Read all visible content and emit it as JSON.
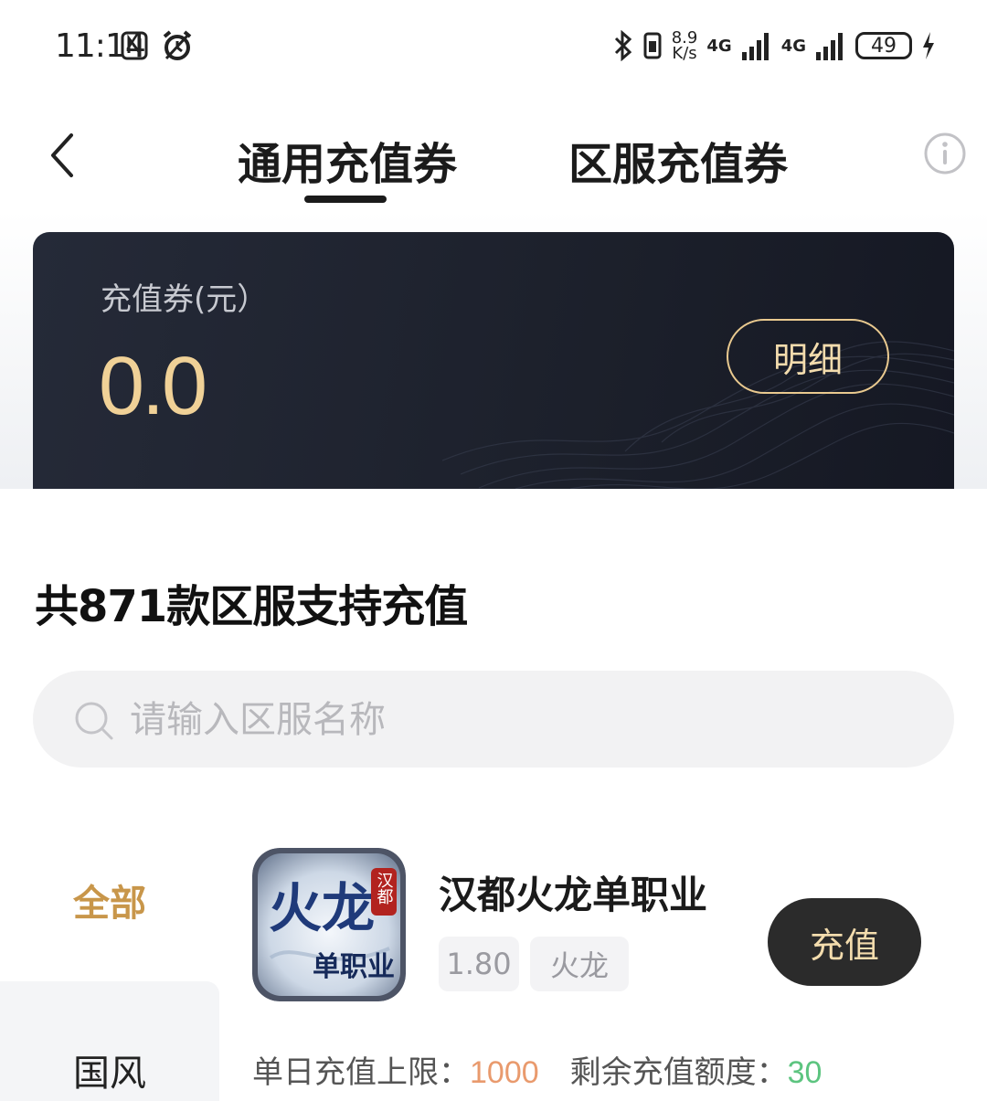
{
  "status_bar": {
    "time": "11:14",
    "net_speed_value": "8.9",
    "net_speed_unit": "K/s",
    "network_1": "4G",
    "network_2": "4G",
    "battery": "49",
    "icons": [
      "nfc-icon",
      "alarm-icon",
      "bluetooth-icon",
      "vibrate-icon",
      "signal-icon",
      "charging-icon"
    ]
  },
  "header": {
    "tabs": [
      {
        "label": "通用充值券",
        "active": true
      },
      {
        "label": "区服充值券",
        "active": false
      }
    ],
    "icons": [
      "back-icon",
      "info-icon"
    ]
  },
  "voucher": {
    "label": "充值券(元）",
    "amount": "0.0",
    "detail_button": "明细"
  },
  "section": {
    "title": "共871款区服支持充值"
  },
  "search": {
    "placeholder": "请输入区服名称"
  },
  "categories": [
    {
      "label": "全部",
      "active": true
    },
    {
      "label": "国风",
      "active": false
    }
  ],
  "game": {
    "name": "汉都火龙单职业",
    "icon_text": "火龙",
    "icon_badge": "汉都",
    "icon_sub": "单职业",
    "tags": [
      "1.80",
      "火龙"
    ],
    "recharge_button": "充值",
    "daily_limit_label": "单日充值上限：",
    "daily_limit_value": "1000",
    "remaining_label": "剩余充值额度：",
    "remaining_value": "30"
  },
  "colors": {
    "accent_gold": "#f0d197",
    "category_active": "#c8964a",
    "limit_orange": "#e99a6d",
    "remaining_green": "#5cc47f",
    "card_dark": "#1c202b"
  }
}
